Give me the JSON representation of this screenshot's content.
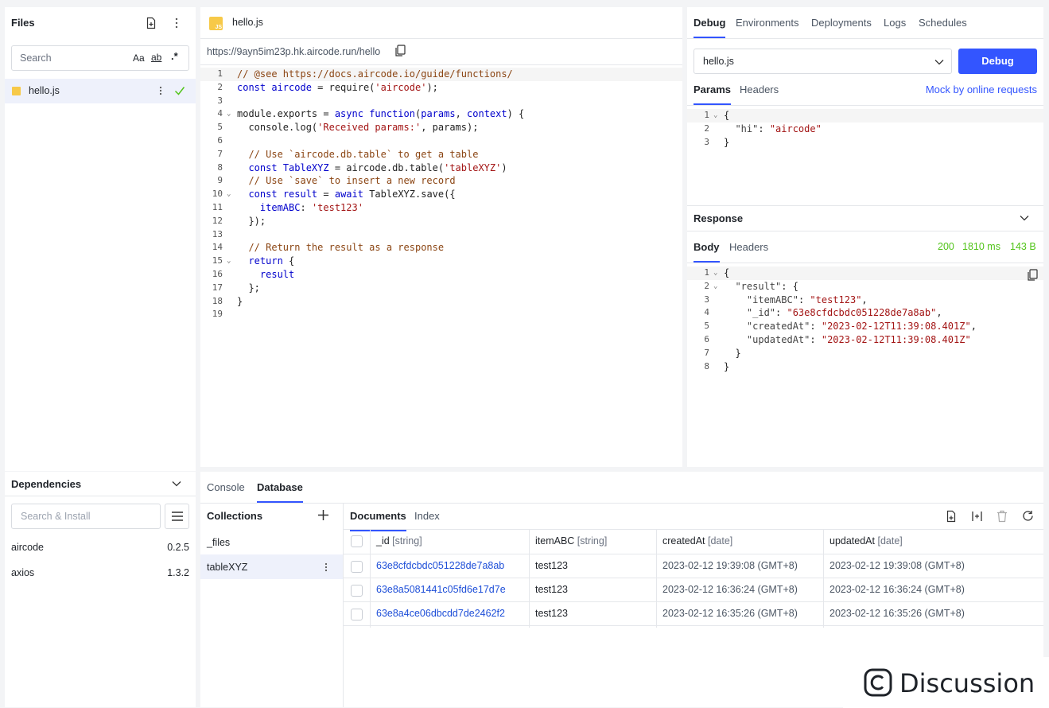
{
  "files": {
    "title": "Files",
    "search_placeholder": "Search",
    "search_opts": [
      "Aa",
      "ab",
      ".*"
    ],
    "items": [
      {
        "name": "hello.js",
        "status": "saved"
      }
    ]
  },
  "dependencies": {
    "title": "Dependencies",
    "search_placeholder": "Search & Install",
    "items": [
      {
        "name": "aircode",
        "version": "0.2.5"
      },
      {
        "name": "axios",
        "version": "1.3.2"
      }
    ]
  },
  "editor": {
    "tab_label": "hello.js",
    "file_badge": "JS",
    "url": "https://9ayn5im23p.hk.aircode.run/hello",
    "lines": [
      {
        "n": "1",
        "fold": false,
        "html": "<span class=\"c-com\">// @see https://docs.aircode.io/guide/functions/</span>"
      },
      {
        "n": "2",
        "fold": false,
        "html": "<span class=\"c-kw\">const</span> <span class=\"c-var\">aircode</span> = require(<span class=\"c-str\">'aircode'</span>);"
      },
      {
        "n": "3",
        "fold": false,
        "html": ""
      },
      {
        "n": "4",
        "fold": true,
        "html": "module.exports = <span class=\"c-kw\">async</span> <span class=\"c-kw\">function</span>(<span class=\"c-var\">params</span>, <span class=\"c-var\">context</span>) {"
      },
      {
        "n": "5",
        "fold": false,
        "html": "  console.log(<span class=\"c-str\">'Received params:'</span>, params);"
      },
      {
        "n": "6",
        "fold": false,
        "html": ""
      },
      {
        "n": "7",
        "fold": false,
        "html": "  <span class=\"c-com\">// Use `aircode.db.table` to get a table</span>"
      },
      {
        "n": "8",
        "fold": false,
        "html": "  <span class=\"c-kw\">const</span> <span class=\"c-var\">TableXYZ</span> = aircode.db.table(<span class=\"c-str\">'tableXYZ'</span>)"
      },
      {
        "n": "9",
        "fold": false,
        "html": "  <span class=\"c-com\">// Use `save` to insert a new record</span>"
      },
      {
        "n": "10",
        "fold": true,
        "html": "  <span class=\"c-kw\">const</span> <span class=\"c-var\">result</span> = <span class=\"c-kw\">await</span> TableXYZ.save({"
      },
      {
        "n": "11",
        "fold": false,
        "html": "    <span class=\"c-var\">itemABC</span>: <span class=\"c-str\">'test123'</span>"
      },
      {
        "n": "12",
        "fold": false,
        "html": "  });"
      },
      {
        "n": "13",
        "fold": false,
        "html": ""
      },
      {
        "n": "14",
        "fold": false,
        "html": "  <span class=\"c-com\">// Return the result as a response</span>"
      },
      {
        "n": "15",
        "fold": true,
        "html": "  <span class=\"c-kw\">return</span> {"
      },
      {
        "n": "16",
        "fold": false,
        "html": "    <span class=\"c-var\">result</span>"
      },
      {
        "n": "17",
        "fold": false,
        "html": "  };"
      },
      {
        "n": "18",
        "fold": false,
        "html": "}"
      },
      {
        "n": "19",
        "fold": false,
        "html": ""
      }
    ]
  },
  "right_tabs": [
    "Debug",
    "Environments",
    "Deployments",
    "Logs",
    "Schedules"
  ],
  "debug": {
    "selected_file": "hello.js",
    "debug_button": "Debug",
    "sub_tabs": [
      "Params",
      "Headers"
    ],
    "mock_link": "Mock by online requests",
    "params_lines": [
      {
        "n": "1",
        "fold": true,
        "html": "{"
      },
      {
        "n": "2",
        "fold": false,
        "html": "  <span class=\"c-key\">\"hi\"</span>: <span class=\"c-str\">\"aircode\"</span>"
      },
      {
        "n": "3",
        "fold": false,
        "html": "}"
      }
    ]
  },
  "response": {
    "title": "Response",
    "sub_tabs": [
      "Body",
      "Headers"
    ],
    "status": "200",
    "time": "1810 ms",
    "size": "143 B",
    "lines": [
      {
        "n": "1",
        "fold": true,
        "html": "{"
      },
      {
        "n": "2",
        "fold": true,
        "html": "  <span class=\"c-key\">\"result\"</span>: {"
      },
      {
        "n": "3",
        "fold": false,
        "html": "    <span class=\"c-key\">\"itemABC\"</span>: <span class=\"c-str\">\"test123\"</span>,"
      },
      {
        "n": "4",
        "fold": false,
        "html": "    <span class=\"c-key\">\"_id\"</span>: <span class=\"c-str\">\"63e8cfdcbdc051228de7a8ab\"</span>,"
      },
      {
        "n": "5",
        "fold": false,
        "html": "    <span class=\"c-key\">\"createdAt\"</span>: <span class=\"c-str\">\"2023-02-12T11:39:08.401Z\"</span>,"
      },
      {
        "n": "6",
        "fold": false,
        "html": "    <span class=\"c-key\">\"updatedAt\"</span>: <span class=\"c-str\">\"2023-02-12T11:39:08.401Z\"</span>"
      },
      {
        "n": "7",
        "fold": false,
        "html": "  }"
      },
      {
        "n": "8",
        "fold": false,
        "html": "}"
      }
    ]
  },
  "bottom_tabs": [
    "Console",
    "Database"
  ],
  "database": {
    "collections_title": "Collections",
    "collections": [
      "_files",
      "tableXYZ"
    ],
    "doc_tabs": [
      "Documents",
      "Index"
    ],
    "columns": [
      {
        "name": "_id",
        "type": "[string]"
      },
      {
        "name": "itemABC",
        "type": "[string]"
      },
      {
        "name": "createdAt",
        "type": "[date]"
      },
      {
        "name": "updatedAt",
        "type": "[date]"
      }
    ],
    "rows": [
      [
        "63e8cfdcbdc051228de7a8ab",
        "test123",
        "2023-02-12 19:39:08 (GMT+8)",
        "2023-02-12 19:39:08 (GMT+8)"
      ],
      [
        "63e8a5081441c05fd6e17d7e",
        "test123",
        "2023-02-12 16:36:24 (GMT+8)",
        "2023-02-12 16:36:24 (GMT+8)"
      ],
      [
        "63e8a4ce06dbcdd7de2462f2",
        "test123",
        "2023-02-12 16:35:26 (GMT+8)",
        "2023-02-12 16:35:26 (GMT+8)"
      ]
    ]
  },
  "watermark": "Discussion",
  "colors": {
    "accent": "#3355ff",
    "success": "#52c41a",
    "link": "#1d4ed8"
  }
}
